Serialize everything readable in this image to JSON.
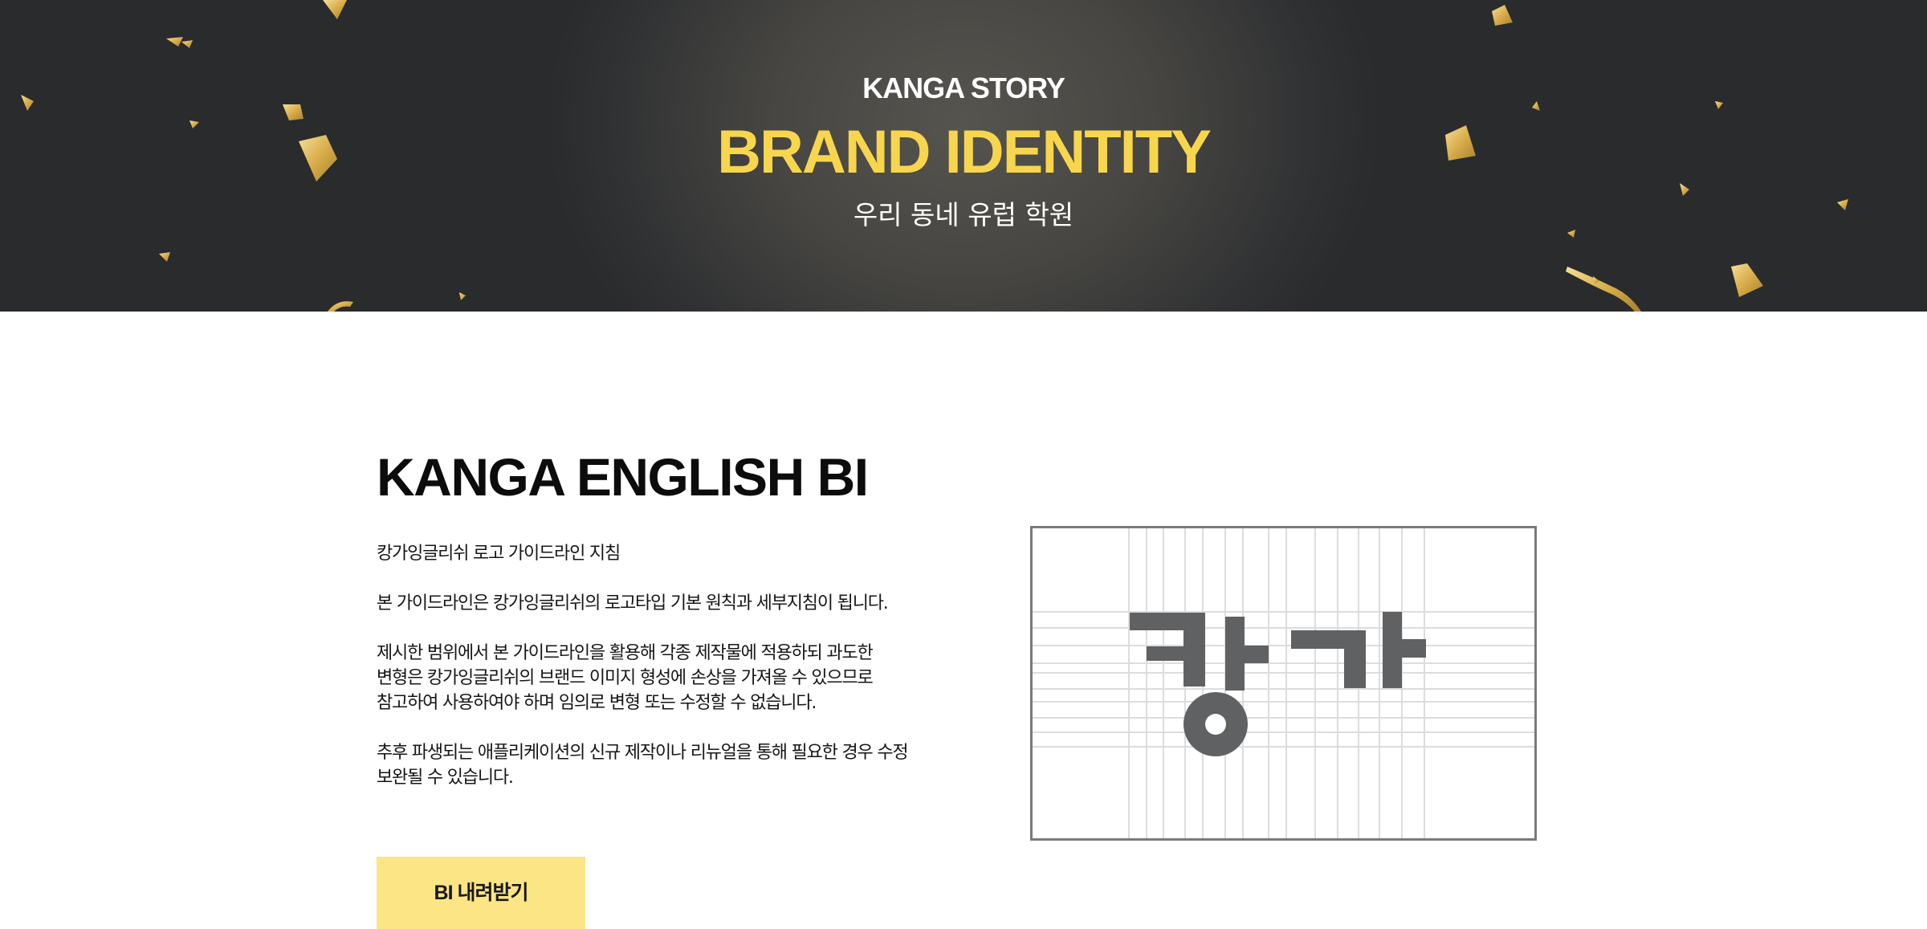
{
  "hero": {
    "kicker": "KANGA STORY",
    "title": "BRAND IDENTITY",
    "subtitle": "우리 동네 유럽 학원"
  },
  "bi_section": {
    "heading": "KANGA ENGLISH BI",
    "paragraphs": [
      "캉가잉글리쉬 로고 가이드라인 지침",
      "본 가이드라인은 캉가잉글리쉬의 로고타입 기본 원칙과 세부지침이 됩니다.",
      "제시한 범위에서 본 가이드라인을 활용해 각종 제작물에 적용하되 과도한\n변형은 캉가잉글리쉬의 브랜드 이미지 형성에 손상을 가져올 수 있으므로\n참고하여 사용하여야 하며 임의로 변형 또는 수정할 수 없습니다.",
      "추후 파생되는 애플리케이션의 신규 제작이나 리뉴얼을 통해 필요한 경우 수정\n보완될 수 있습니다."
    ],
    "download_label": "BI 내려받기",
    "logo_wordmark": "캉가"
  },
  "colors": {
    "hero_dark": "#2d2e30",
    "hero_accent_yellow": "#f7d64e",
    "button_yellow": "#fce585",
    "logo_gray": "#5f6163",
    "grid_line": "#d9d9d9",
    "confetti_gold": "#e2bf63"
  },
  "icons": {
    "confetti": "gold-confetti-decoration"
  }
}
